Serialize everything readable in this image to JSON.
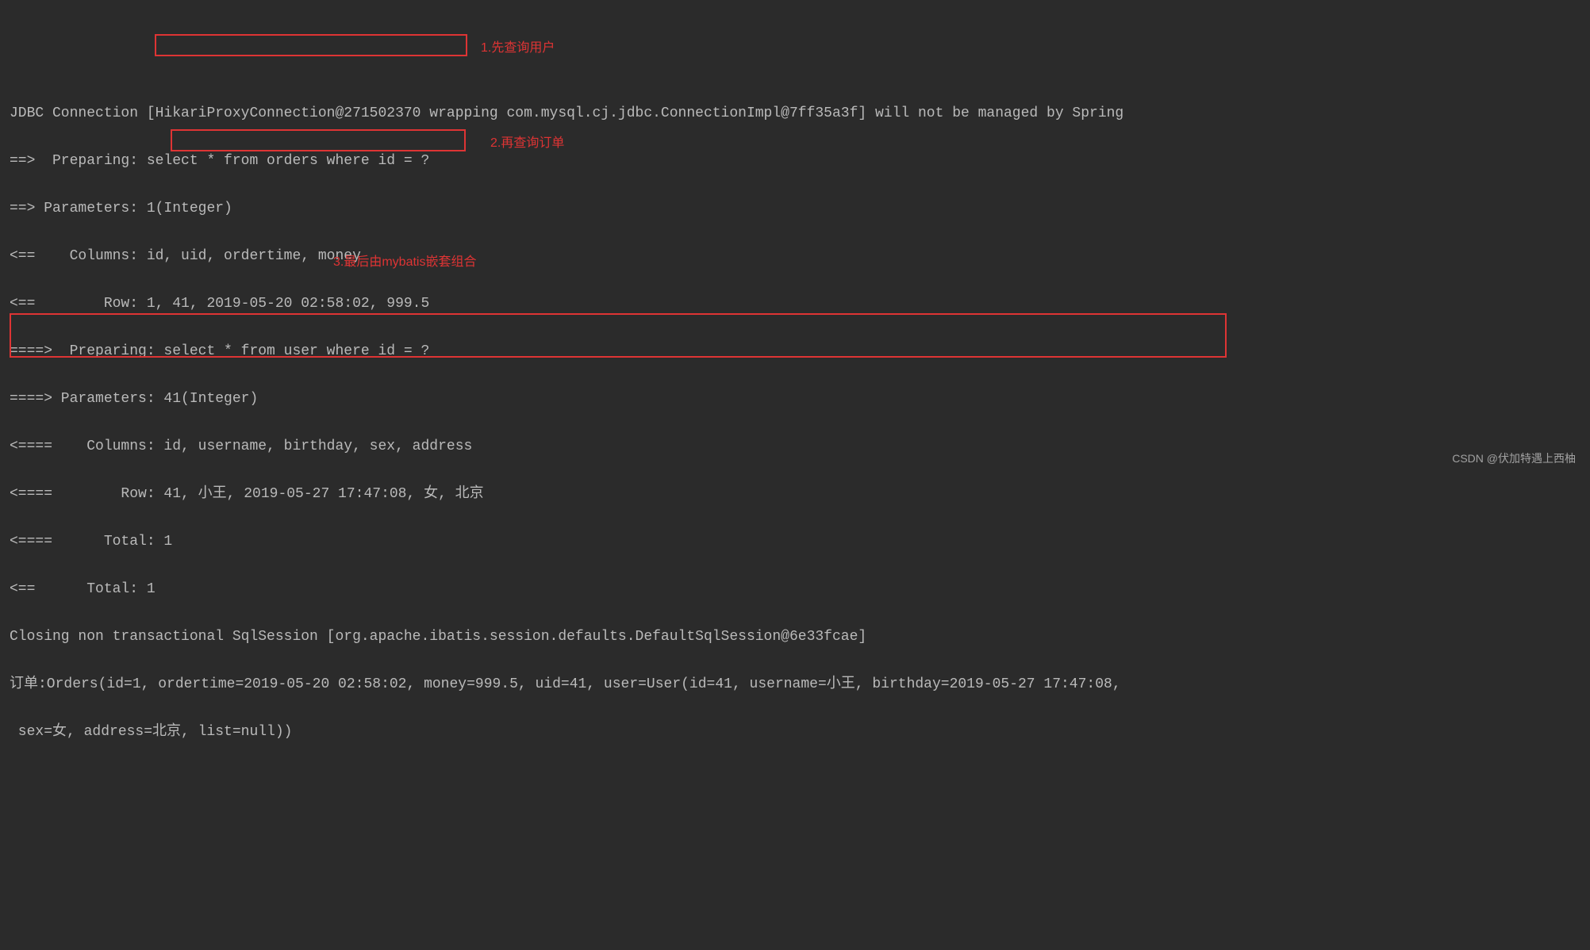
{
  "log": {
    "l1": "JDBC Connection [HikariProxyConnection@271502370 wrapping com.mysql.cj.jdbc.ConnectionImpl@7ff35a3f] will not be managed by Spring",
    "l2": "==>  Preparing: select * from orders where id = ?",
    "l3": "==> Parameters: 1(Integer)",
    "l4": "<==    Columns: id, uid, ordertime, money",
    "l5": "<==        Row: 1, 41, 2019-05-20 02:58:02, 999.5",
    "l6": "====>  Preparing: select * from user where id = ?",
    "l7": "====> Parameters: 41(Integer)",
    "l8": "<====    Columns: id, username, birthday, sex, address",
    "l9": "<====        Row: 41, 小王, 2019-05-27 17:47:08, 女, 北京",
    "l10": "<====      Total: 1",
    "l11": "<==      Total: 1",
    "l12": "Closing non transactional SqlSession [org.apache.ibatis.session.defaults.DefaultSqlSession@6e33fcae]",
    "l13": "订单:Orders(id=1, ordertime=2019-05-20 02:58:02, money=999.5, uid=41, user=User(id=41, username=小王, birthday=2019-05-27 17:47:08,",
    "l14": " sex=女, address=北京, list=null))"
  },
  "annotations": {
    "a1": "1.先查询用户",
    "a2": "2.再查询订单",
    "a3": "3.最后由mybatis嵌套组合"
  },
  "watermark": "CSDN @伏加特遇上西柚"
}
